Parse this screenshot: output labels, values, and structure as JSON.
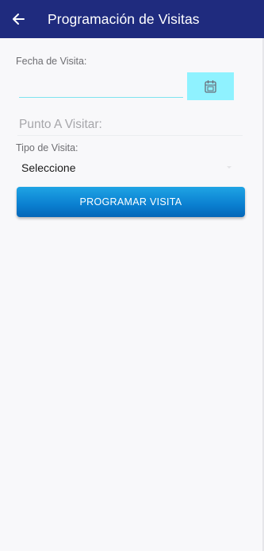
{
  "app_bar": {
    "title": "Programación de Visitas",
    "back_icon": "arrow-left-icon"
  },
  "form": {
    "date_label": "Fecha de Visita:",
    "date_value": "",
    "calendar_icon": "calendar-icon",
    "point_placeholder": "Punto A Visitar:",
    "type_label": "Tipo de Visita:",
    "type_selected": "Seleccione",
    "submit_label": "PROGRAMAR VISITA"
  },
  "colors": {
    "app_bar": "#1f2b7e",
    "calendar_button": "#8ff2ff",
    "primary_button": "#0a7fd0",
    "background": "#f8f8fa"
  }
}
